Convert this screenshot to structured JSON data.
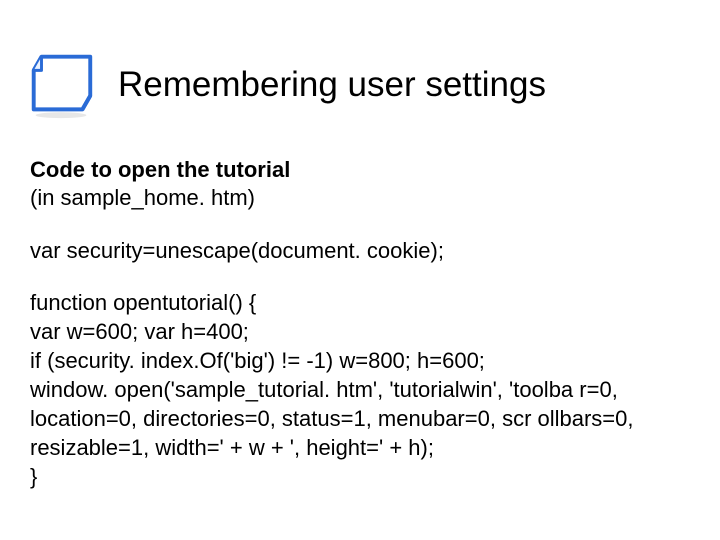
{
  "title": "Remembering user settings",
  "section": {
    "head": "Code to open the tutorial",
    "sub": "(in sample_home. htm)"
  },
  "code": {
    "line1": "var security=unescape(document. cookie);",
    "fn_open": "function opentutorial() {",
    "fn_vars": "var w=600; var h=400;",
    "fn_if": "if (security. index.Of('big') != -1) w=800; h=600;",
    "fn_win": "window. open('sample_tutorial. htm', 'tutorialwin', 'toolba r=0, location=0, directories=0, status=1, menubar=0, scr ollbars=0, resizable=1, width=' + w + ', height=' + h);",
    "fn_close": "}"
  }
}
